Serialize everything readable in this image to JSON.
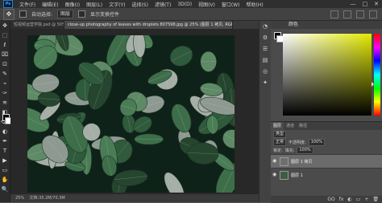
{
  "app": {
    "logo": "Ps"
  },
  "menubar": {
    "items": [
      "文件(F)",
      "编辑(E)",
      "图像(I)",
      "图层(L)",
      "文字(Y)",
      "选择(S)",
      "滤镜(T)",
      "3D(D)",
      "视图(V)",
      "窗口(W)",
      "帮助(H)"
    ],
    "window_controls": [
      "—",
      "□",
      "✕"
    ]
  },
  "options": {
    "tool_icon": "move-tool",
    "auto_select_label": "自动选择:",
    "auto_select_value": "图层",
    "show_transform_label": "显示变换控件"
  },
  "tabs": [
    {
      "label": "短视频运营学院.psd @ 50%",
      "active": false
    },
    {
      "label": "close-up photography of leaves with droplets 807598.jpg @ 25% (图层 1 拷贝, RGB/8#)*",
      "active": true
    }
  ],
  "status": {
    "zoom": "25%",
    "doc": "文档:35.2M/70.3M"
  },
  "color_panel": {
    "tab_label": "颜色",
    "hue_color": "#e3ea00"
  },
  "layers_panel": {
    "tabs": [
      "图层",
      "通道",
      "路径"
    ],
    "kind_label": "类型",
    "blend_mode": "正常",
    "opacity_label": "不透明度:",
    "opacity_value": "100%",
    "lock_label": "锁定:",
    "fill_label": "填充:",
    "fill_value": "100%",
    "layers": [
      {
        "name": "图层 1 拷贝",
        "active": true,
        "thumb_color": "#6e6e6e"
      },
      {
        "name": "图层 1",
        "active": false,
        "thumb_color": "#3e5c44"
      }
    ],
    "actions": [
      "GO",
      "fx",
      "◐",
      "▭",
      "+",
      "🗑"
    ]
  },
  "toolbar": {
    "tools": [
      "✥",
      "⬚",
      "ℓ",
      "⌧",
      "⊡",
      "✎",
      "⌁",
      "✑",
      "≋",
      "◧",
      "⌫",
      "◐",
      "✒",
      "T",
      "▶",
      "▭",
      "✋",
      "🔍",
      "…"
    ]
  },
  "strip": {
    "icons": [
      "◔",
      "⚙",
      "☰",
      "▤",
      "◎",
      "✦"
    ]
  }
}
